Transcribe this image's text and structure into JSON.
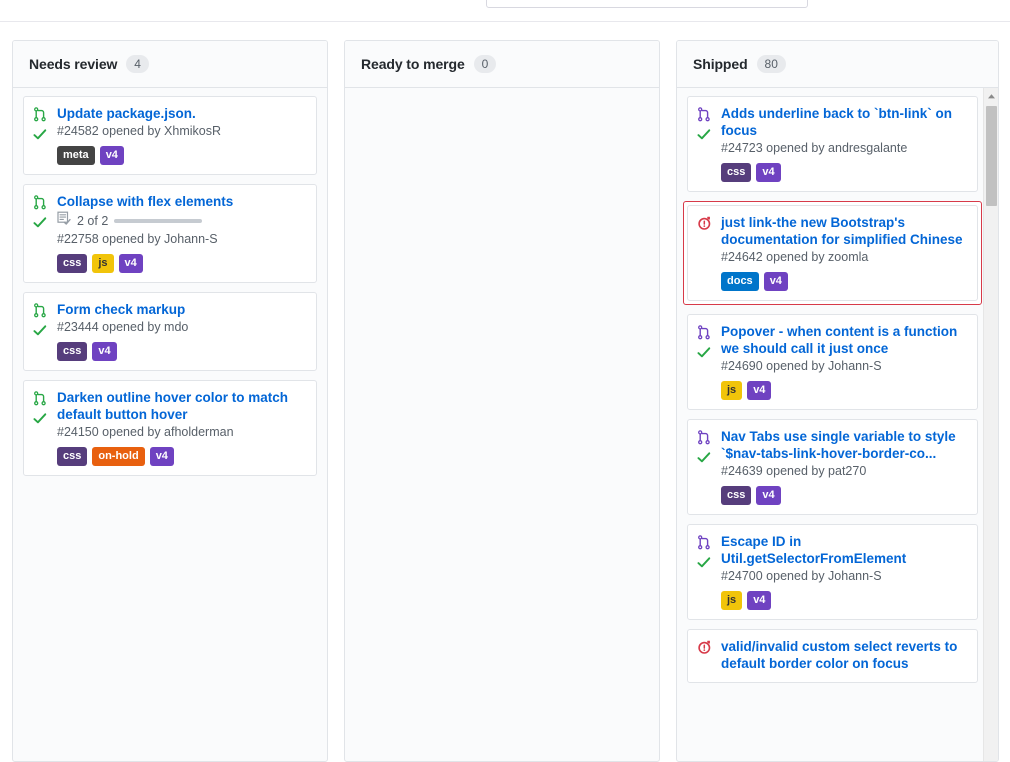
{
  "search": {
    "placeholder": ""
  },
  "colors": {
    "link": "#0366d6",
    "label_meta": "#444444",
    "label_v4": "#6f42c1",
    "label_css": "#563d7c",
    "label_js": "#f1c40a",
    "label_onhold": "#e8600f",
    "label_docs": "#0075ca",
    "pr_open": "#28a745",
    "pr_merged": "#6f42c1",
    "pr_closed": "#d73a49",
    "check": "#28a745",
    "highlight_border": "#d73a49"
  },
  "board": {
    "columns": [
      {
        "title": "Needs review",
        "count": "4",
        "cards": [
          {
            "title": "Update package.json.",
            "meta": "#24582 opened by XhmikosR",
            "pr_state": "open",
            "check": true,
            "tasks": null,
            "labels": [
              {
                "text": "meta",
                "color": "#444444",
                "fg": "#ffffff"
              },
              {
                "text": "v4",
                "color": "#6f42c1",
                "fg": "#ffffff"
              }
            ],
            "highlighted": false
          },
          {
            "title": "Collapse with flex elements",
            "meta": "#22758 opened by Johann-S",
            "pr_state": "open",
            "check": true,
            "tasks": {
              "text": "2 of 2",
              "progress": 100
            },
            "labels": [
              {
                "text": "css",
                "color": "#563d7c",
                "fg": "#ffffff"
              },
              {
                "text": "js",
                "color": "#f1c40a",
                "fg": "#333333"
              },
              {
                "text": "v4",
                "color": "#6f42c1",
                "fg": "#ffffff"
              }
            ],
            "highlighted": false
          },
          {
            "title": "Form check markup",
            "meta": "#23444 opened by mdo",
            "pr_state": "open",
            "check": true,
            "tasks": null,
            "labels": [
              {
                "text": "css",
                "color": "#563d7c",
                "fg": "#ffffff"
              },
              {
                "text": "v4",
                "color": "#6f42c1",
                "fg": "#ffffff"
              }
            ],
            "highlighted": false
          },
          {
            "title": "Darken outline hover color to match default button hover",
            "meta": "#24150 opened by afholderman",
            "pr_state": "open",
            "check": true,
            "tasks": null,
            "labels": [
              {
                "text": "css",
                "color": "#563d7c",
                "fg": "#ffffff"
              },
              {
                "text": "on-hold",
                "color": "#e8600f",
                "fg": "#ffffff"
              },
              {
                "text": "v4",
                "color": "#6f42c1",
                "fg": "#ffffff"
              }
            ],
            "highlighted": false
          }
        ]
      },
      {
        "title": "Ready to merge",
        "count": "0",
        "cards": []
      },
      {
        "title": "Shipped",
        "count": "80",
        "scrollable": true,
        "cards": [
          {
            "title": "Adds underline back to `btn-link` on focus",
            "meta": "#24723 opened by andresgalante",
            "pr_state": "merged",
            "check": true,
            "tasks": null,
            "labels": [
              {
                "text": "css",
                "color": "#563d7c",
                "fg": "#ffffff"
              },
              {
                "text": "v4",
                "color": "#6f42c1",
                "fg": "#ffffff"
              }
            ],
            "highlighted": false
          },
          {
            "title": "just link-the new Bootstrap's documentation for simplified Chinese",
            "meta": "#24642 opened by zoomla",
            "pr_state": "closed",
            "check": false,
            "tasks": null,
            "labels": [
              {
                "text": "docs",
                "color": "#0075ca",
                "fg": "#ffffff"
              },
              {
                "text": "v4",
                "color": "#6f42c1",
                "fg": "#ffffff"
              }
            ],
            "highlighted": true
          },
          {
            "title": "Popover - when content is a function we should call it just once",
            "meta": "#24690 opened by Johann-S",
            "pr_state": "merged",
            "check": true,
            "tasks": null,
            "labels": [
              {
                "text": "js",
                "color": "#f1c40a",
                "fg": "#333333"
              },
              {
                "text": "v4",
                "color": "#6f42c1",
                "fg": "#ffffff"
              }
            ],
            "highlighted": false
          },
          {
            "title": "Nav Tabs use single variable to style `$nav-tabs-link-hover-border-co...",
            "meta": "#24639 opened by pat270",
            "pr_state": "merged",
            "check": true,
            "tasks": null,
            "labels": [
              {
                "text": "css",
                "color": "#563d7c",
                "fg": "#ffffff"
              },
              {
                "text": "v4",
                "color": "#6f42c1",
                "fg": "#ffffff"
              }
            ],
            "highlighted": false
          },
          {
            "title": "Escape ID in Util.getSelectorFromElement",
            "meta": "#24700 opened by Johann-S",
            "pr_state": "merged",
            "check": true,
            "tasks": null,
            "labels": [
              {
                "text": "js",
                "color": "#f1c40a",
                "fg": "#333333"
              },
              {
                "text": "v4",
                "color": "#6f42c1",
                "fg": "#ffffff"
              }
            ],
            "highlighted": false
          },
          {
            "title": "valid/invalid custom select reverts to default border color on focus",
            "meta": "",
            "pr_state": "closed",
            "check": false,
            "tasks": null,
            "labels": [],
            "highlighted": false
          }
        ]
      }
    ]
  }
}
